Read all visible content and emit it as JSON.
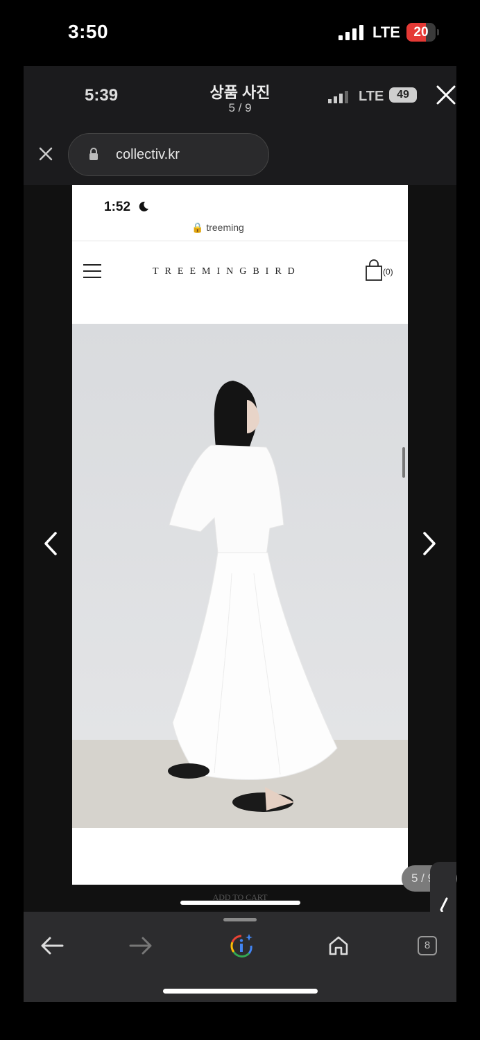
{
  "status_bar": {
    "time": "3:50",
    "network": "LTE",
    "battery": "20"
  },
  "viewer": {
    "inner_time": "5:39",
    "title": "상품 사진",
    "counter": "5 / 9",
    "inner_network": "LTE",
    "inner_battery": "49",
    "url": "collectiv.kr",
    "page_badge": "5 / 9"
  },
  "webpage": {
    "time": "1:52",
    "url": "treeming",
    "brand": "TREEMINGBIRD",
    "cart_count": "(0)",
    "add_to_cart": "ADD TO CART"
  },
  "toolbar": {
    "tab_count": "8"
  },
  "colors": {
    "battery_low": "#e53935",
    "page_bg": "#ffffff",
    "photo_wall": "#dcdee2"
  }
}
